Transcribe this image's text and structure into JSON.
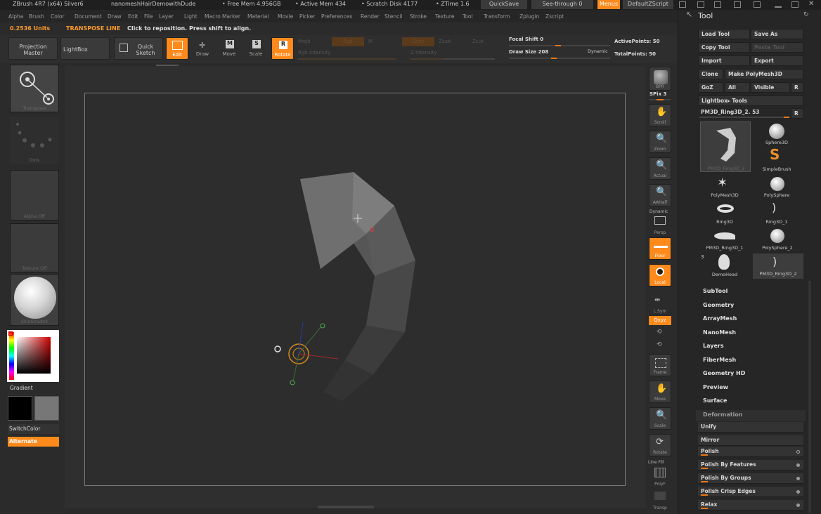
{
  "titlebar": {
    "app": "ZBrush 4R7 (x64) Silver6",
    "doc": "nanomeshHairDemowithDude",
    "free_mem": "• Free Mem 4.956GB",
    "active_mem": "• Active Mem 434",
    "scratch": "• Scratch Disk 4177",
    "ztime": "• ZTime 1.6",
    "quicksave": "QuickSave",
    "seethrough": "See-through  0",
    "menus": "Menus",
    "script": "DefaultZScript"
  },
  "menus": [
    "Alpha",
    "Brush",
    "Color",
    "Document",
    "Draw",
    "Edit",
    "File",
    "Layer",
    "Light",
    "Macro",
    "Marker",
    "Material",
    "Movie",
    "Picker",
    "Preferences",
    "Render",
    "Stencil",
    "Stroke",
    "Texture",
    "Tool",
    "Transform",
    "Zplugin",
    "Zscript"
  ],
  "status": {
    "units": "0.2536 Units",
    "mode": "TRANSPOSE LINE",
    "hint": "Click to reposition. Press shift to align."
  },
  "toolbar": {
    "projection_master": "Projection Master",
    "lightbox": "LightBox",
    "quick_sketch": "Quick Sketch",
    "edit": "Edit",
    "draw": "Draw",
    "move": "Move",
    "scale": "Scale",
    "rotate": "Rotate",
    "mrgb": "Mrgb",
    "rgb": "Rgb",
    "m": "M",
    "zadd": "Zadd",
    "zsub": "Zsub",
    "zcut": "Zcut",
    "rgb_intensity": "Rgb Intensity",
    "z_intensity": "Z Intensity",
    "focal_shift": "Focal Shift 0",
    "draw_size": "Draw Size 208",
    "dynamic": "Dynamic",
    "active_points": "ActivePoints: 50",
    "total_points": "TotalPoints: 50"
  },
  "leftshelf": {
    "transpose": "Transpose",
    "dots": "Dots",
    "alpha_off": "Alpha Off",
    "texture_off": "Texture Off",
    "material": "SkinShade4",
    "gradient": "Gradient",
    "switchcolor": "SwitchColor",
    "alternate": "Alternate"
  },
  "rightshelf": {
    "bpr": "BPR",
    "spix": "SPix 3",
    "scroll": "Scroll",
    "zoom": "Zoom",
    "actual": "Actual",
    "aahalf": "AAHalf",
    "dynamic": "Dynamic",
    "persp": "Persp",
    "floor": "Floor",
    "local": "Local",
    "lsym": "L.Sym",
    "xyz": "Qxyz",
    "frame": "Frame",
    "move": "Move",
    "scale": "Scale",
    "rotate": "Rotate",
    "line_fill": "Line Fill",
    "polyf": "PolyF",
    "transp": "Transp"
  },
  "toolpanel": {
    "title": "Tool",
    "load_tool": "Load Tool",
    "save_as": "Save As",
    "copy_tool": "Copy Tool",
    "paste_tool": "Paste Tool",
    "import": "Import",
    "export": "Export",
    "clone": "Clone",
    "make_polymesh": "Make PolyMesh3D",
    "goz": "GoZ",
    "all": "All",
    "visible": "Visible",
    "r": "R",
    "lightbox_tools": "Lightbox▸ Tools",
    "current_tool": "PM3D_Ring3D_2. 53",
    "r2": "R",
    "thumbs": [
      {
        "label": "PM3D_Ring3D_2"
      },
      {
        "label": "Sphere3D"
      },
      {
        "label": "SimpleBrush"
      },
      {
        "label": "PolyMesh3D"
      },
      {
        "label": "PolySphere"
      },
      {
        "label": "Ring3D"
      },
      {
        "label": "Ring3D_1"
      },
      {
        "label": "PM3D_Ring3D_1"
      },
      {
        "label": "PolySphere_2"
      },
      {
        "label": "DemoHead"
      },
      {
        "label": "PM3D_Ring3D_2"
      }
    ],
    "thumb_count": "3",
    "sections": [
      "SubTool",
      "Geometry",
      "ArrayMesh",
      "NanoMesh",
      "Layers",
      "FiberMesh",
      "Geometry HD",
      "Preview",
      "Surface",
      "Deformation"
    ],
    "deformation": [
      "Unify",
      "Mirror",
      "Polish",
      "Polish By Features",
      "Polish By Groups",
      "Polish Crisp Edges",
      "Relax"
    ]
  },
  "colors": {
    "accent": "#ff8a1c",
    "panel": "#262626",
    "canvas": "#2d2d2d"
  }
}
